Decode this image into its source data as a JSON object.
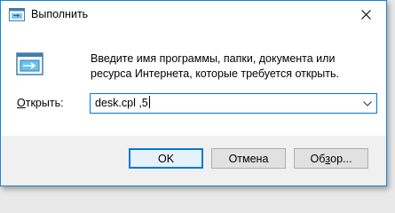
{
  "window": {
    "title": "Выполнить",
    "app_icon": "run-icon",
    "close_icon": "close-icon"
  },
  "body": {
    "description": "Введите имя программы, папки, документа или ресурса Интернета, которые требуется открыть.",
    "open_label_underlined": "О",
    "open_label_rest": "ткрыть:",
    "input_value": "desk.cpl ,5",
    "dropdown_icon": "chevron-down-icon"
  },
  "buttons": {
    "ok": "OK",
    "cancel": "Отмена",
    "browse_prefix": "Об",
    "browse_underlined": "з",
    "browse_suffix": "ор..."
  },
  "colors": {
    "accent": "#0078d7",
    "footer_bg": "#f0f0f0"
  }
}
